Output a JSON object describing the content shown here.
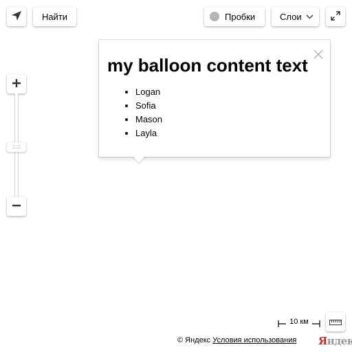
{
  "toolbar": {
    "search_label": "Найти",
    "traffic_label": "Пробки",
    "layers_label": "Слои"
  },
  "zoom": {
    "runner_grip": ":::::"
  },
  "balloon": {
    "title": "my balloon content text",
    "items": [
      "Logan",
      "Sofia",
      "Mason",
      "Layla"
    ]
  },
  "scale": {
    "label": "10 км"
  },
  "footer": {
    "copyright": "© Яндекс",
    "terms_link": "Условия использования",
    "logo_first": "Я",
    "logo_rest": "ндекс"
  },
  "colors": {
    "logo_red": "#cc2a2a",
    "logo_grey": "#999999",
    "traffic_dot": "#b5b5b5"
  },
  "icons": {
    "geolocation": "geolocation-arrow-icon",
    "traffic": "traffic-circle-icon",
    "layers_arrow": "chevron-down-icon",
    "fullscreen": "fullscreen-expand-icon",
    "zoom_in": "plus-icon",
    "zoom_out": "minus-icon",
    "close": "close-icon",
    "ruler": "ruler-icon"
  }
}
